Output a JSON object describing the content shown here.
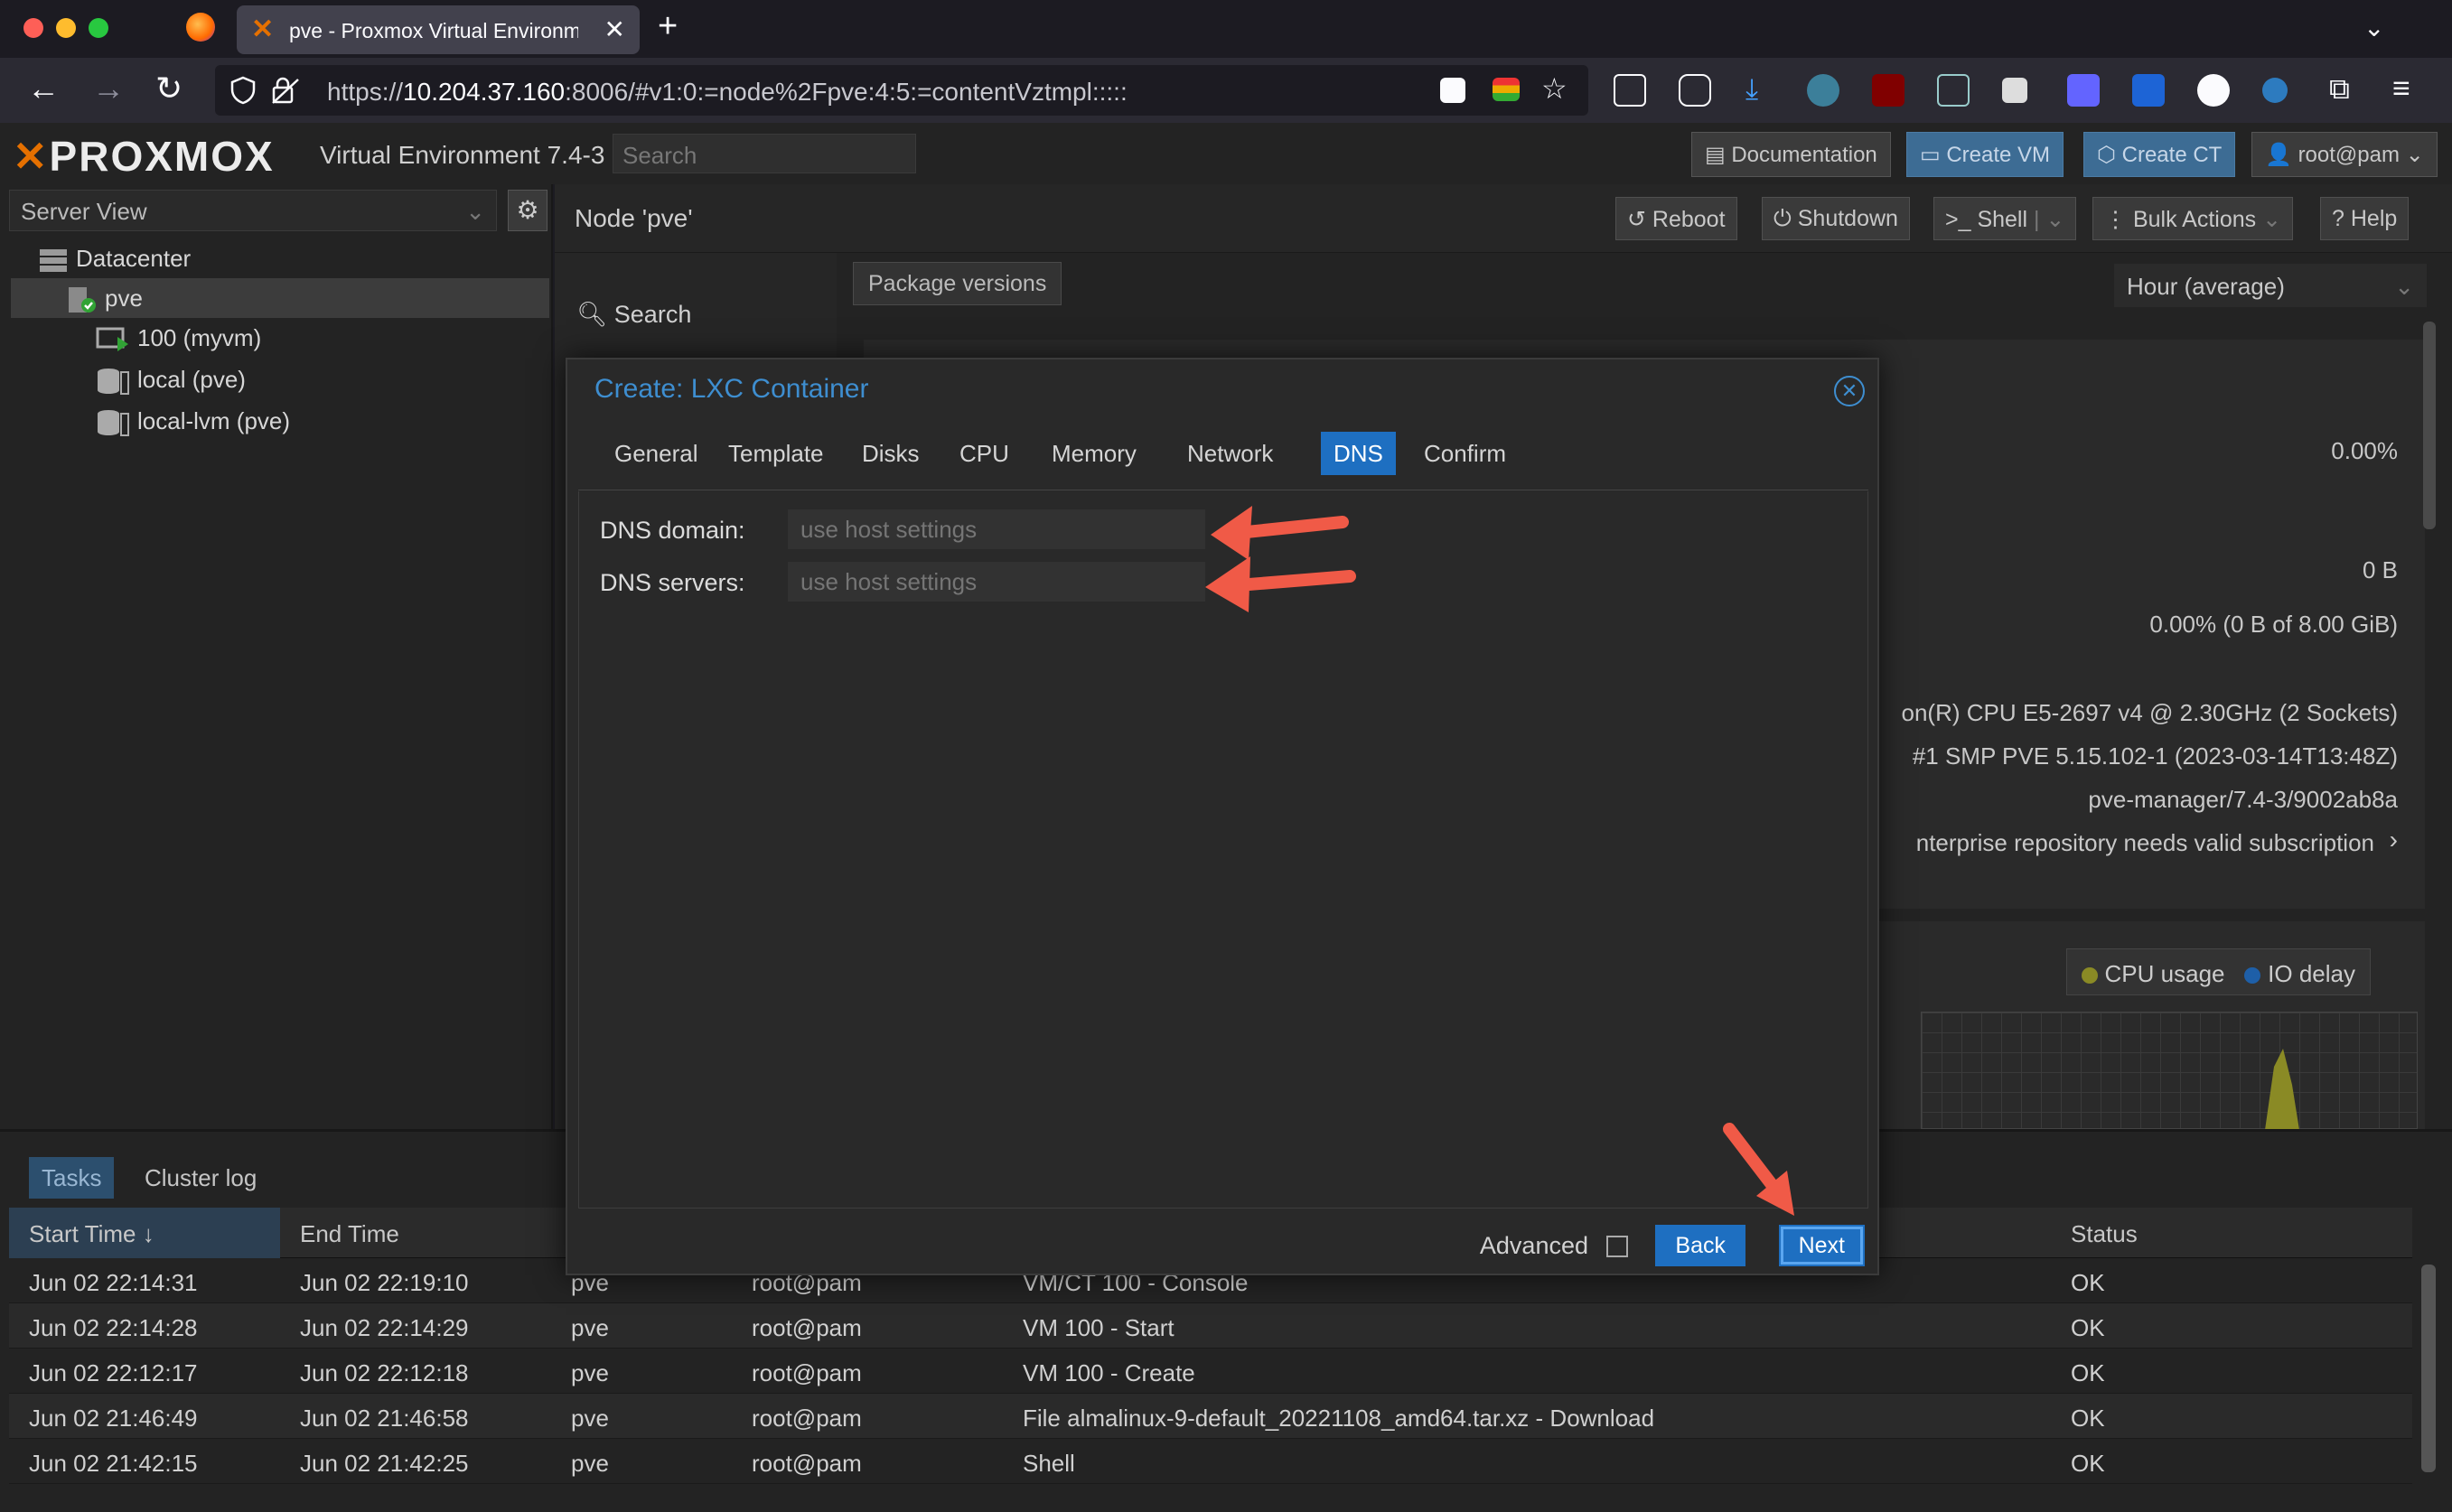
{
  "browser": {
    "tab_title": "pve - Proxmox Virtual Environme",
    "url_prefix": "https://",
    "url_host": "10.204.37.160",
    "url_rest": ":8006/#v1:0:=node%2Fpve:4:5:=contentVztmpl:::::",
    "close_glyph": "✕",
    "newtab_glyph": "+",
    "tablist_glyph": "⌄"
  },
  "app": {
    "logo": "PROXMOX",
    "version": "Virtual Environment 7.4-3",
    "search_placeholder": "Search",
    "buttons": {
      "documentation": "Documentation",
      "create_vm": "Create VM",
      "create_ct": "Create CT",
      "user": "root@pam"
    }
  },
  "tree": {
    "view": "Server View",
    "items": [
      {
        "label": "Datacenter",
        "icon": "datacenter-icon"
      },
      {
        "label": "pve",
        "icon": "server-online-icon"
      },
      {
        "label": "100 (myvm)",
        "icon": "vm-running-icon"
      },
      {
        "label": "local (pve)",
        "icon": "storage-icon"
      },
      {
        "label": "local-lvm (pve)",
        "icon": "storage-icon"
      }
    ]
  },
  "node": {
    "title": "Node 'pve'",
    "buttons": {
      "reboot": "Reboot",
      "shutdown": "Shutdown",
      "shell": "Shell",
      "bulk": "Bulk Actions",
      "help": "Help"
    },
    "subnav_search": "Search",
    "package_versions": "Package versions",
    "timeframe": "Hour (average)",
    "stats": [
      "0.00%",
      "0 B",
      "0.00% (0 B of 8.00 GiB)",
      "on(R) CPU E5-2697 v4 @ 2.30GHz (2 Sockets)",
      "#1 SMP PVE 5.15.102-1 (2023-03-14T13:48Z)",
      "pve-manager/7.4-3/9002ab8a",
      "nterprise repository needs valid subscription"
    ],
    "legend": {
      "cpu": "CPU usage",
      "io": "IO delay"
    }
  },
  "modal": {
    "title": "Create: LXC Container",
    "tabs": [
      "General",
      "Template",
      "Disks",
      "CPU",
      "Memory",
      "Network",
      "DNS",
      "Confirm"
    ],
    "active_tab": "DNS",
    "fields": {
      "dns_domain_label": "DNS domain:",
      "dns_domain_placeholder": "use host settings",
      "dns_servers_label": "DNS servers:",
      "dns_servers_placeholder": "use host settings"
    },
    "advanced_label": "Advanced",
    "back": "Back",
    "next": "Next"
  },
  "tasks": {
    "tabs": [
      "Tasks",
      "Cluster log"
    ],
    "columns": {
      "start": "Start Time ↓",
      "end": "End Time",
      "status": "Status"
    },
    "rows": [
      {
        "start": "Jun 02 22:14:31",
        "end": "Jun 02 22:19:10",
        "node": "pve",
        "user": "root@pam",
        "desc": "VM/CT 100 - Console",
        "status": "OK"
      },
      {
        "start": "Jun 02 22:14:28",
        "end": "Jun 02 22:14:29",
        "node": "pve",
        "user": "root@pam",
        "desc": "VM 100 - Start",
        "status": "OK"
      },
      {
        "start": "Jun 02 22:12:17",
        "end": "Jun 02 22:12:18",
        "node": "pve",
        "user": "root@pam",
        "desc": "VM 100 - Create",
        "status": "OK"
      },
      {
        "start": "Jun 02 21:46:49",
        "end": "Jun 02 21:46:58",
        "node": "pve",
        "user": "root@pam",
        "desc": "File almalinux-9-default_20221108_amd64.tar.xz - Download",
        "status": "OK"
      },
      {
        "start": "Jun 02 21:42:15",
        "end": "Jun 02 21:42:25",
        "node": "pve",
        "user": "root@pam",
        "desc": "Shell",
        "status": "OK"
      }
    ]
  },
  "colors": {
    "accent": "#1e6fc1",
    "brand_orange": "#e57000",
    "annotation_arrow": "#f05a47"
  }
}
